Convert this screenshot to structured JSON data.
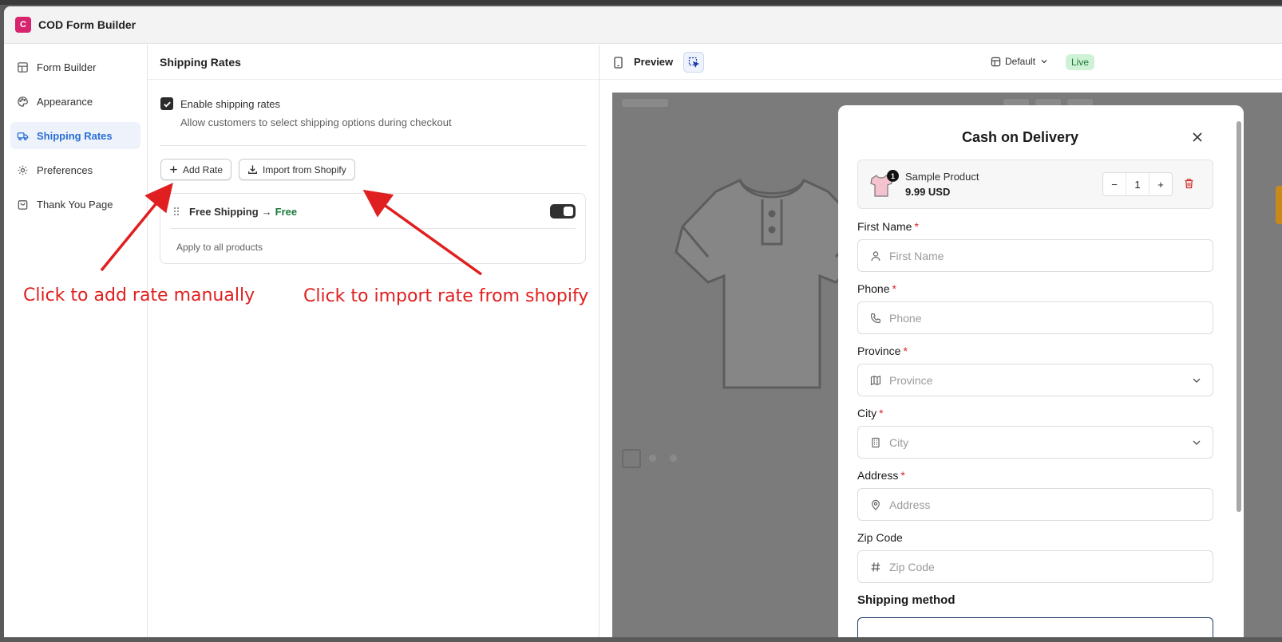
{
  "app": {
    "title": "COD Form Builder",
    "logo_text": "C"
  },
  "sidebar": {
    "items": [
      {
        "label": "Form Builder",
        "icon": "layout-icon",
        "active": false
      },
      {
        "label": "Appearance",
        "icon": "palette-icon",
        "active": false
      },
      {
        "label": "Shipping Rates",
        "icon": "truck-icon",
        "active": true
      },
      {
        "label": "Preferences",
        "icon": "gear-icon",
        "active": false
      },
      {
        "label": "Thank You Page",
        "icon": "bag-icon",
        "active": false
      }
    ]
  },
  "settings": {
    "title": "Shipping Rates",
    "enable_label": "Enable shipping rates",
    "enable_checked": true,
    "enable_desc": "Allow customers to select shipping options during checkout",
    "add_rate_label": "Add Rate",
    "import_label": "Import from Shopify",
    "rate": {
      "name": "Free Shipping",
      "arrow": "→",
      "price": "Free",
      "scope": "Apply to all products",
      "enabled": true
    }
  },
  "annotations": {
    "add_hint": "Click to add rate manually",
    "import_hint": "Click to import rate from shopify",
    "color": "#e02020"
  },
  "preview": {
    "label": "Preview",
    "layout_label": "Default",
    "status": "Live",
    "modal": {
      "title": "Cash on Delivery",
      "product": {
        "name": "Sample Product",
        "price": "9.99 USD",
        "quantity": "1",
        "badge": "1",
        "minus": "−",
        "plus": "+"
      },
      "fields": [
        {
          "label": "First Name",
          "required": true,
          "placeholder": "First Name",
          "icon": "user-icon",
          "select": false
        },
        {
          "label": "Phone",
          "required": true,
          "placeholder": "Phone",
          "icon": "phone-icon",
          "select": false
        },
        {
          "label": "Province",
          "required": true,
          "placeholder": "Province",
          "icon": "map-icon",
          "select": true
        },
        {
          "label": "City",
          "required": true,
          "placeholder": "City",
          "icon": "building-icon",
          "select": true
        },
        {
          "label": "Address",
          "required": true,
          "placeholder": "Address",
          "icon": "pin-icon",
          "select": false
        },
        {
          "label": "Zip Code",
          "required": false,
          "placeholder": "Zip Code",
          "icon": "hash-icon",
          "select": false
        }
      ],
      "shipping_title": "Shipping method"
    }
  },
  "colors": {
    "accent": "#2a6fd6",
    "live_bg": "#cdf2d5",
    "live_fg": "#1f7a38",
    "free_price": "#1a7a3c",
    "required": "#e02424",
    "trash": "#d23030"
  }
}
